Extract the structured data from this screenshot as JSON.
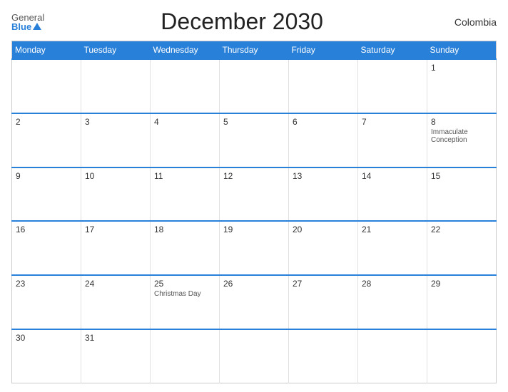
{
  "header": {
    "logo_general": "General",
    "logo_blue": "Blue",
    "title": "December 2030",
    "country": "Colombia"
  },
  "calendar": {
    "days_of_week": [
      "Monday",
      "Tuesday",
      "Wednesday",
      "Thursday",
      "Friday",
      "Saturday",
      "Sunday"
    ],
    "weeks": [
      [
        {
          "day": "",
          "holiday": ""
        },
        {
          "day": "",
          "holiday": ""
        },
        {
          "day": "",
          "holiday": ""
        },
        {
          "day": "",
          "holiday": ""
        },
        {
          "day": "",
          "holiday": ""
        },
        {
          "day": "",
          "holiday": ""
        },
        {
          "day": "1",
          "holiday": ""
        }
      ],
      [
        {
          "day": "2",
          "holiday": ""
        },
        {
          "day": "3",
          "holiday": ""
        },
        {
          "day": "4",
          "holiday": ""
        },
        {
          "day": "5",
          "holiday": ""
        },
        {
          "day": "6",
          "holiday": ""
        },
        {
          "day": "7",
          "holiday": ""
        },
        {
          "day": "8",
          "holiday": "Immaculate Conception"
        }
      ],
      [
        {
          "day": "9",
          "holiday": ""
        },
        {
          "day": "10",
          "holiday": ""
        },
        {
          "day": "11",
          "holiday": ""
        },
        {
          "day": "12",
          "holiday": ""
        },
        {
          "day": "13",
          "holiday": ""
        },
        {
          "day": "14",
          "holiday": ""
        },
        {
          "day": "15",
          "holiday": ""
        }
      ],
      [
        {
          "day": "16",
          "holiday": ""
        },
        {
          "day": "17",
          "holiday": ""
        },
        {
          "day": "18",
          "holiday": ""
        },
        {
          "day": "19",
          "holiday": ""
        },
        {
          "day": "20",
          "holiday": ""
        },
        {
          "day": "21",
          "holiday": ""
        },
        {
          "day": "22",
          "holiday": ""
        }
      ],
      [
        {
          "day": "23",
          "holiday": ""
        },
        {
          "day": "24",
          "holiday": ""
        },
        {
          "day": "25",
          "holiday": "Christmas Day"
        },
        {
          "day": "26",
          "holiday": ""
        },
        {
          "day": "27",
          "holiday": ""
        },
        {
          "day": "28",
          "holiday": ""
        },
        {
          "day": "29",
          "holiday": ""
        }
      ],
      [
        {
          "day": "30",
          "holiday": ""
        },
        {
          "day": "31",
          "holiday": ""
        },
        {
          "day": "",
          "holiday": ""
        },
        {
          "day": "",
          "holiday": ""
        },
        {
          "day": "",
          "holiday": ""
        },
        {
          "day": "",
          "holiday": ""
        },
        {
          "day": "",
          "holiday": ""
        }
      ]
    ]
  }
}
